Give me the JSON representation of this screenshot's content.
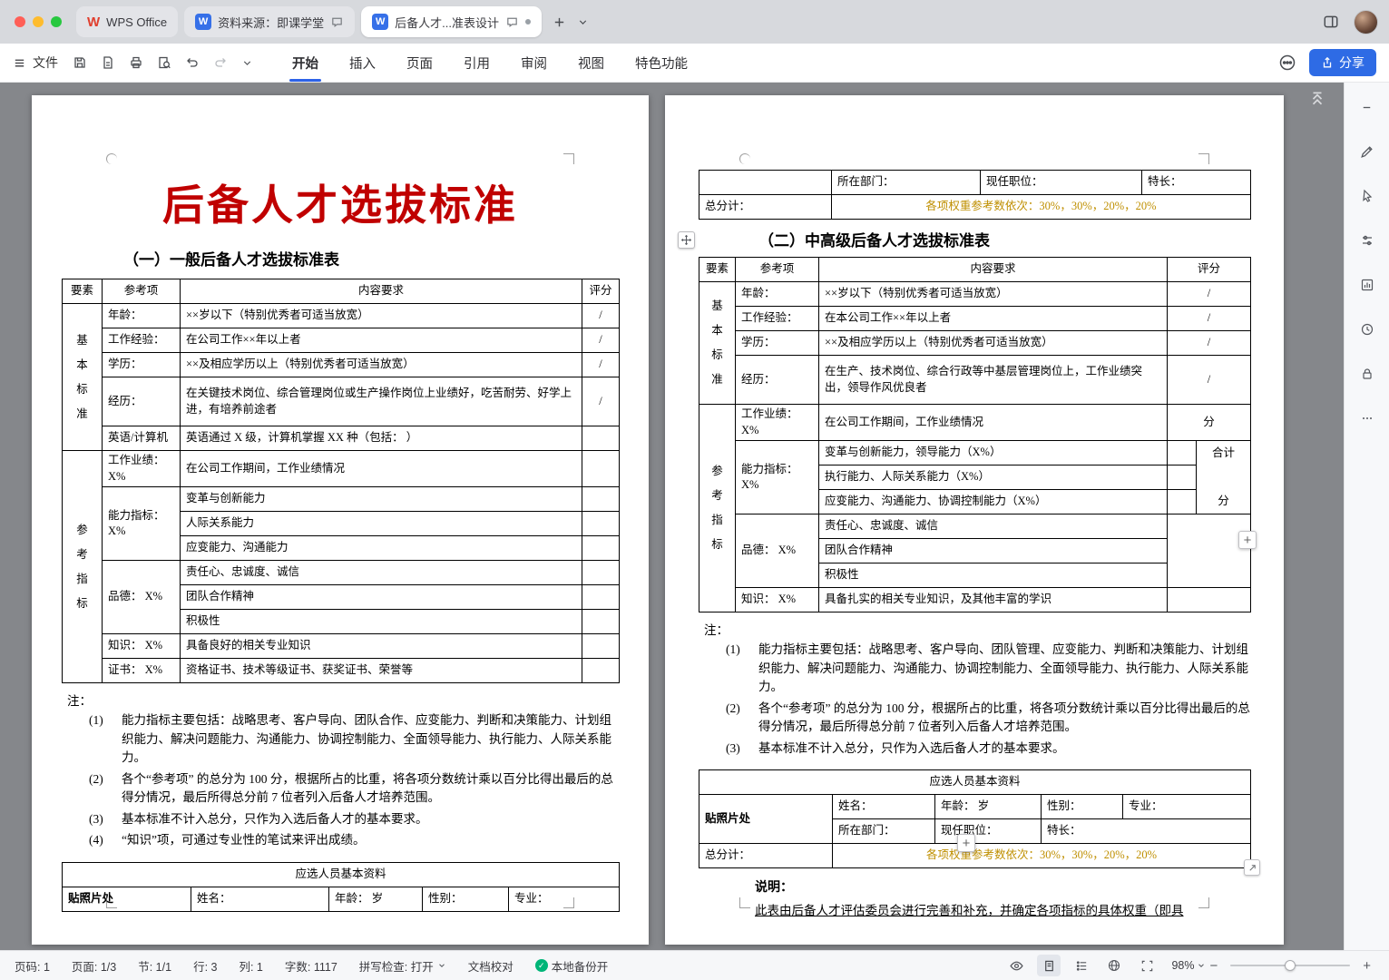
{
  "colors": {
    "accent_blue": "#2e6be5",
    "title_red": "#c00000",
    "weights_orange": "#bf8f00",
    "backup_green": "#00b578"
  },
  "chrome": {
    "tabs": [
      {
        "label": "WPS Office"
      },
      {
        "label": "资料来源：即课学堂"
      },
      {
        "label": "后备人才...准表设计"
      }
    ],
    "file_menu": "文件",
    "ribbon_tabs": [
      "开始",
      "插入",
      "页面",
      "引用",
      "审阅",
      "视图",
      "特色功能"
    ],
    "share_label": "分享"
  },
  "doc": {
    "p1": {
      "title": "后备人才选拔标准",
      "subtitle": "（一）一般后备人才选拔标准表",
      "headers": [
        "要素",
        "参考项",
        "内容要求",
        "评分"
      ],
      "group_basic": "基本标准",
      "group_ref": "参考指标",
      "rows": {
        "age": {
          "k": "年龄：",
          "v": "××岁以下（特别优秀者可适当放宽）",
          "s": "/"
        },
        "exp": {
          "k": "工作经验：",
          "v": "在公司工作××年以上者",
          "s": "/"
        },
        "edu": {
          "k": "学历：",
          "v": "××及相应学历以上（特别优秀者可适当放宽）",
          "s": "/"
        },
        "his": {
          "k": "经历：",
          "v": "在关键技术岗位、综合管理岗位或生产操作岗位上业绩好，吃苦耐劳、好学上进，有培养前途者",
          "s": "/"
        },
        "eng": {
          "k": "英语/计算机",
          "v": "英语通过 X 级，计算机掌握 XX 种（包括：          ）"
        },
        "perf": {
          "k": "工作业绩：X%",
          "v": "在公司工作期间，工作业绩情况"
        },
        "cap": {
          "k": "能力指标：X%",
          "v1": "变革与创新能力",
          "v2": "人际关系能力",
          "v3": "应变能力、沟通能力"
        },
        "moral": {
          "k": "品德：  X%",
          "v1": "责任心、忠诚度、诚信",
          "v2": "团队合作精神",
          "v3": "积极性"
        },
        "know": {
          "k": "知识：  X%",
          "v": "具备良好的相关专业知识"
        },
        "cert": {
          "k": "证书：  X%",
          "v": "资格证书、技术等级证书、获奖证书、荣誉等"
        }
      },
      "note_label": "注：",
      "notes": [
        {
          "n": "(1)",
          "t": "能力指标主要包括：战略思考、客户导向、团队合作、应变能力、判断和决策能力、计划组织能力、解决问题能力、沟通能力、协调控制能力、全面领导能力、执行能力、人际关系能力。"
        },
        {
          "n": "(2)",
          "t": "各个“参考项” 的总分为 100 分，根据所占的比重，将各项分数统计乘以百分比得出最后的总得分情况，最后所得总分前 7 位者列入后备人才培养范围。"
        },
        {
          "n": "(3)",
          "t": "基本标准不计入总分，只作为入选后备人才的基本要求。"
        },
        {
          "n": "(4)",
          "t": "“知识”项，可通过专业性的笔试来评出成绩。"
        }
      ],
      "info_title": "应选人员基本资料",
      "photo": "贴照片处",
      "f_name": "姓名：",
      "f_age": "年龄：      岁",
      "f_gender": "性别：",
      "f_major": "专业："
    },
    "p2": {
      "cont": {
        "dept": "所在部门：",
        "pos": "现任职位：",
        "spec": "特长：",
        "total": "总分计：",
        "weights": "各项权重参考数依次：30%，30%，20%，20%"
      },
      "subtitle": "（二）中高级后备人才选拔标准表",
      "headers": [
        "要素",
        "参考项",
        "内容要求",
        "评分"
      ],
      "group_basic": "基本标准",
      "group_ref": "参考指标",
      "rows": {
        "age": {
          "k": "年龄：",
          "v": "××岁以下（特别优秀者可适当放宽）",
          "s": "/"
        },
        "exp": {
          "k": "工作经验：",
          "v": "在本公司工作××年以上者",
          "s": "/"
        },
        "edu": {
          "k": "学历：",
          "v": "××及相应学历以上（特别优秀者可适当放宽）",
          "s": "/"
        },
        "his": {
          "k": "经历：",
          "v": "在生产、技术岗位、综合行政等中基层管理岗位上，工作业绩突出，领导作风优良者",
          "s": "/"
        },
        "perf": {
          "k": "工作业绩：X%",
          "v": "在公司工作期间，工作业绩情况",
          "s": "分"
        },
        "cap": {
          "k": "能力指标：X%",
          "v1": "变革与创新能力，领导能力（X%）",
          "v2": "执行能力、人际关系能力（X%）",
          "v3": "应变能力、沟通能力、协调控制能力（X%）",
          "sum": "合计",
          "fen": "分"
        },
        "moral": {
          "k": "品德：  X%",
          "v1": "责任心、忠诚度、诚信",
          "v2": "团队合作精神",
          "v3": "积极性"
        },
        "know": {
          "k": "知识：  X%",
          "v": "具备扎实的相关专业知识，及其他丰富的学识"
        }
      },
      "note_label": "注：",
      "notes": [
        {
          "n": "(1)",
          "t": "能力指标主要包括：战略思考、客户导向、团队管理、应变能力、判断和决策能力、计划组织能力、解决问题能力、沟通能力、协调控制能力、全面领导能力、执行能力、人际关系能力。"
        },
        {
          "n": "(2)",
          "t": "各个“参考项” 的总分为 100 分，根据所占的比重，将各项分数统计乘以百分比得出最后的总得分情况，最后所得总分前 7 位者列入后备人才培养范围。"
        },
        {
          "n": "(3)",
          "t": "基本标准不计入总分，只作为入选后备人才的基本要求。"
        }
      ],
      "info_title": "应选人员基本资料",
      "photo": "贴照片处",
      "f_name": "姓名：",
      "f_age": "年龄：      岁",
      "f_gender": "性别：",
      "f_major": "专业：",
      "f_dept": "所在部门：",
      "f_pos": "现任职位：",
      "f_spec": "特长：",
      "total": "总分计：",
      "weights": "各项权重参考数依次：30%，30%，20%，20%",
      "explain_label": "说明：",
      "explain_text": "此表由后备人才评估委员会进行完善和补充，并确定各项指标的具体权重（即具"
    }
  },
  "status": {
    "page_no": "页码: 1",
    "page_count": "页面: 1/3",
    "section": "节: 1/1",
    "line": "行: 3",
    "column": "列: 1",
    "words": "字数: 1117",
    "spell": "拼写检查: 打开",
    "proof": "文档校对",
    "backup": "本地备份开",
    "zoom": "98%"
  }
}
